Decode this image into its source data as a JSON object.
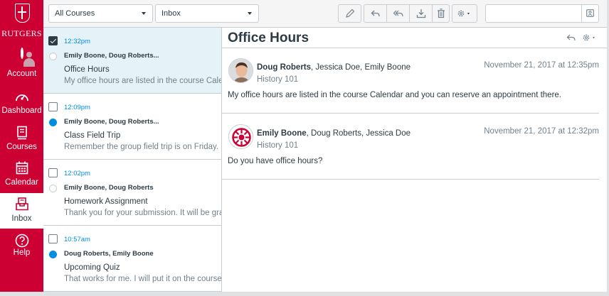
{
  "brand": {
    "name": "RUTGERS",
    "color": "#cc0033"
  },
  "nav": [
    {
      "label": "Account",
      "icon": "account-avatar-icon"
    },
    {
      "label": "Dashboard",
      "icon": "dashboard-gauge-icon"
    },
    {
      "label": "Courses",
      "icon": "courses-book-icon"
    },
    {
      "label": "Calendar",
      "icon": "calendar-icon"
    },
    {
      "label": "Inbox",
      "icon": "inbox-tray-icon",
      "active": true
    },
    {
      "label": "Help",
      "icon": "help-question-icon"
    }
  ],
  "toolbar": {
    "course_filter": "All Courses",
    "folder_filter": "Inbox",
    "search_placeholder": "",
    "icons": [
      "compose-icon",
      "reply-icon",
      "reply-all-icon",
      "archive-icon",
      "delete-icon",
      "settings-gear-icon",
      "search-people-icon"
    ]
  },
  "conversations": [
    {
      "time": "12:32pm",
      "participants": "Emily Boone, Doug Roberts...",
      "subject": "Office Hours",
      "preview": "My office hours are listed in the course Calendar and you can reserve an appointment there.",
      "selected": true,
      "unread": false
    },
    {
      "time": "12:09pm",
      "participants": "Emily Boone, Doug Roberts...",
      "subject": "Class Field Trip",
      "preview": "Remember the group field trip is on Friday.",
      "selected": false,
      "unread": true
    },
    {
      "time": "12:02pm",
      "participants": "Emily Boone, Doug Roberts",
      "subject": "Homework Assignment",
      "preview": "Thank you for your submission. It will be graded soon.",
      "selected": false,
      "unread": false
    },
    {
      "time": "10:57am",
      "participants": "Doug Roberts, Emily Boone",
      "subject": "Upcoming Quiz",
      "preview": "That works for me. I will put it on the course calendar.",
      "selected": false,
      "unread": true
    }
  ],
  "thread": {
    "title": "Office Hours",
    "messages": [
      {
        "author": "Doug Roberts",
        "others": ", Jessica Doe, Emily Boone",
        "course": "History 101",
        "date": "November 21, 2017 at 12:35pm",
        "body": "My office hours are listed in the course Calendar and you can reserve an appointment there."
      },
      {
        "author": "Emily Boone",
        "others": ", Doug Roberts, Jessica Doe",
        "course": "History 101",
        "date": "November 21, 2017 at 12:32pm",
        "body": "Do you have office hours?"
      }
    ]
  },
  "colors": {
    "link_blue": "#008ee2",
    "text": "#2d3b45",
    "muted": "#73818c",
    "selected_bg": "#e5f2f8"
  }
}
